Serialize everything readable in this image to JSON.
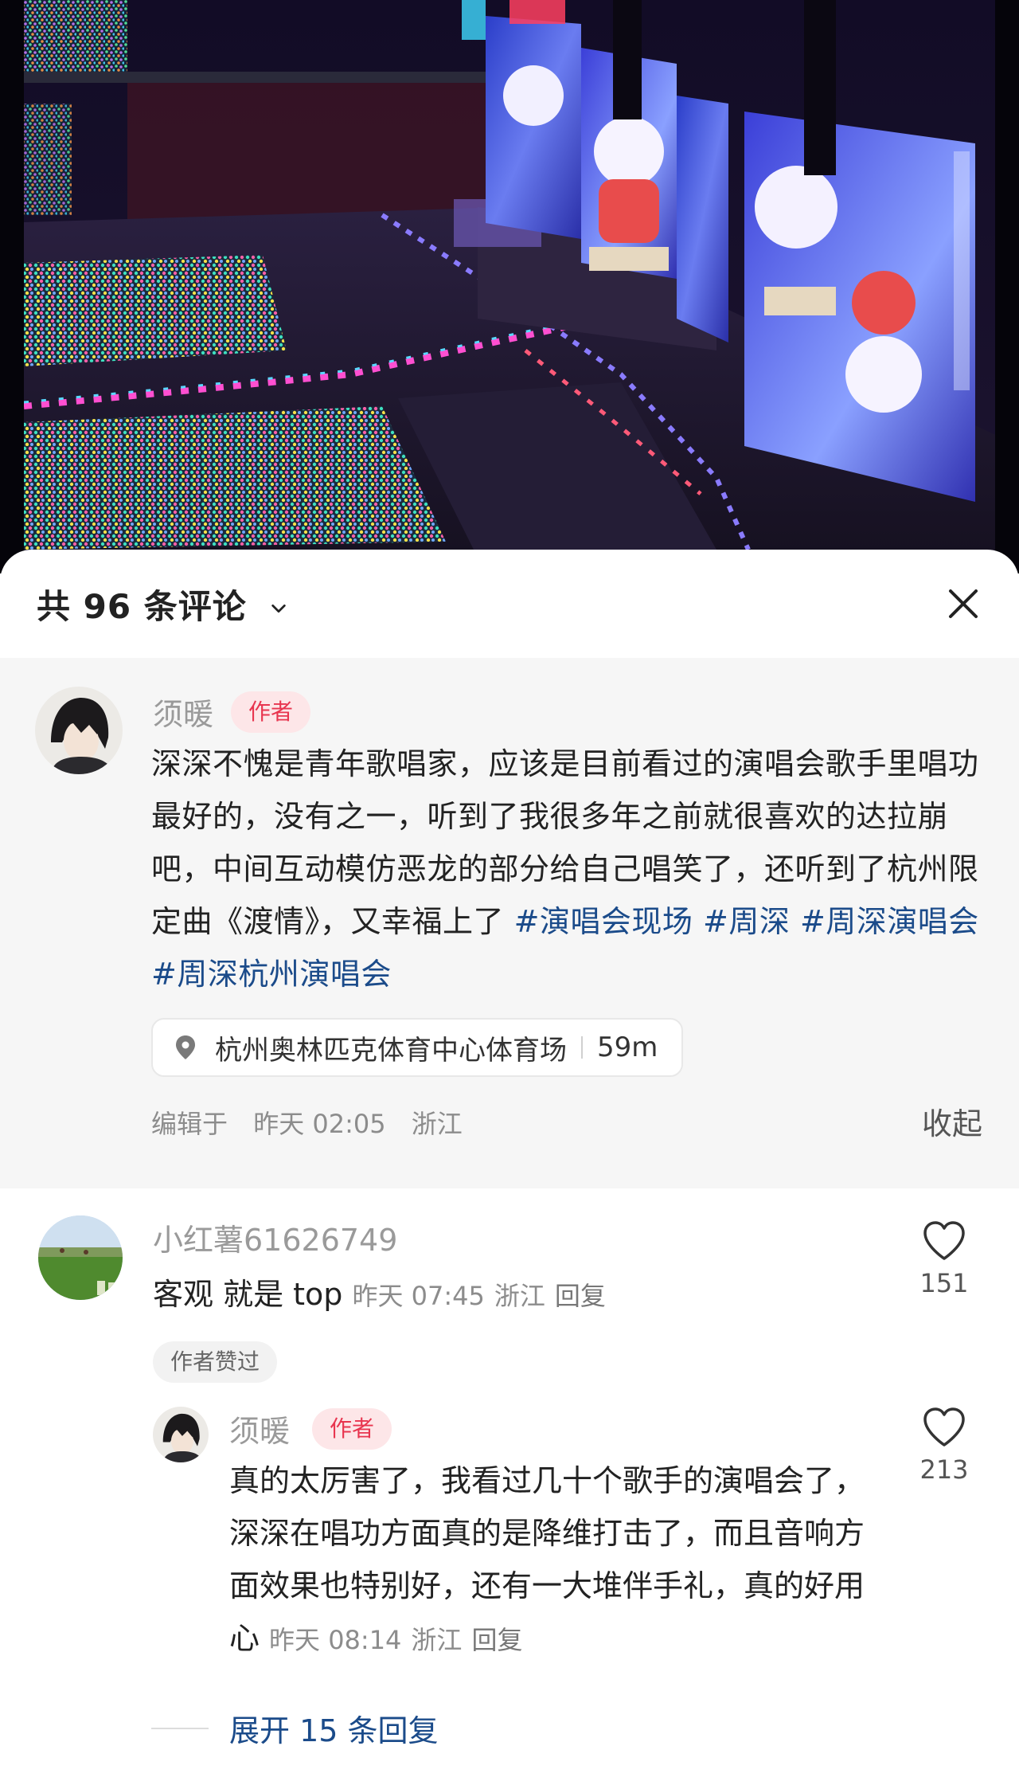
{
  "header": {
    "comment_count": "共 96 条评论"
  },
  "post": {
    "username": "须暖",
    "author_badge": "作者",
    "text_plain": "深深不愧是青年歌唱家，应该是目前看过的演唱会歌手里唱功最好的，没有之一，听到了我很多年之前就很喜欢的达拉崩吧，中间互动模仿恶龙的部分给自己唱笑了，还听到了杭州限定曲《渡情》，又幸福上了 ",
    "tags": [
      "#演唱会现场",
      "#周深",
      "#周深演唱会",
      "#周深杭州演唱会"
    ],
    "location": "杭州奥林匹克体育中心体育场",
    "distance": "59m",
    "edited_label": "编辑于",
    "edited_time": "昨天 02:05",
    "region": "浙江",
    "collapse_label": "收起"
  },
  "comments": [
    {
      "username": "小红薯61626749",
      "text": "客观 就是 top",
      "time": "昨天 07:45",
      "region": "浙江",
      "reply_label": "回复",
      "liked_by_author": "作者赞过",
      "likes": "151"
    },
    {
      "username": "须暖",
      "author_badge": "作者",
      "text": "真的太厉害了，我看过几十个歌手的演唱会了，深深在唱功方面真的是降维打击了，而且音响方面效果也特别好，还有一大堆伴手礼，真的好用心",
      "time": "昨天 08:14",
      "region": "浙江",
      "reply_label": "回复",
      "likes": "213"
    }
  ],
  "expand_replies": "展开 15 条回复",
  "icons": {
    "close": "close-icon",
    "chevron": "chevron-down-icon",
    "location": "location-pin-icon",
    "like": "heart-icon"
  },
  "colors": {
    "tag": "#1b4b8a",
    "author_badge_bg": "#fde6e8",
    "author_badge_text": "#e8354f"
  }
}
